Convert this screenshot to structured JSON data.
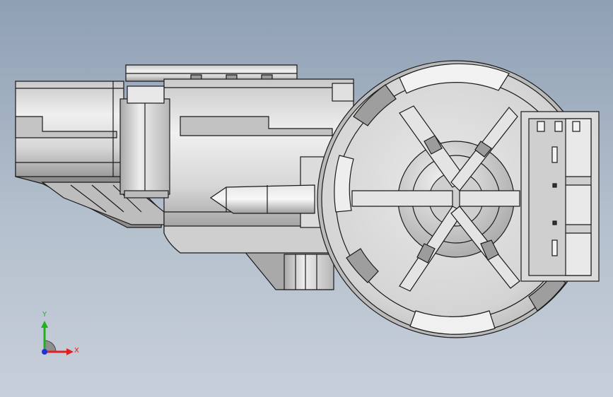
{
  "viewport": {
    "background_top": "#8f9fb4",
    "background_bottom": "#c7cfda"
  },
  "model": {
    "body_color": "#d9d9d9",
    "shadow_color": "#9a9a9a",
    "edge_color": "#1a1a1a"
  },
  "triad": {
    "x_label": "X",
    "y_label": "Y",
    "x_color": "#e02020",
    "y_color": "#20b020",
    "z_color": "#2030e0"
  }
}
